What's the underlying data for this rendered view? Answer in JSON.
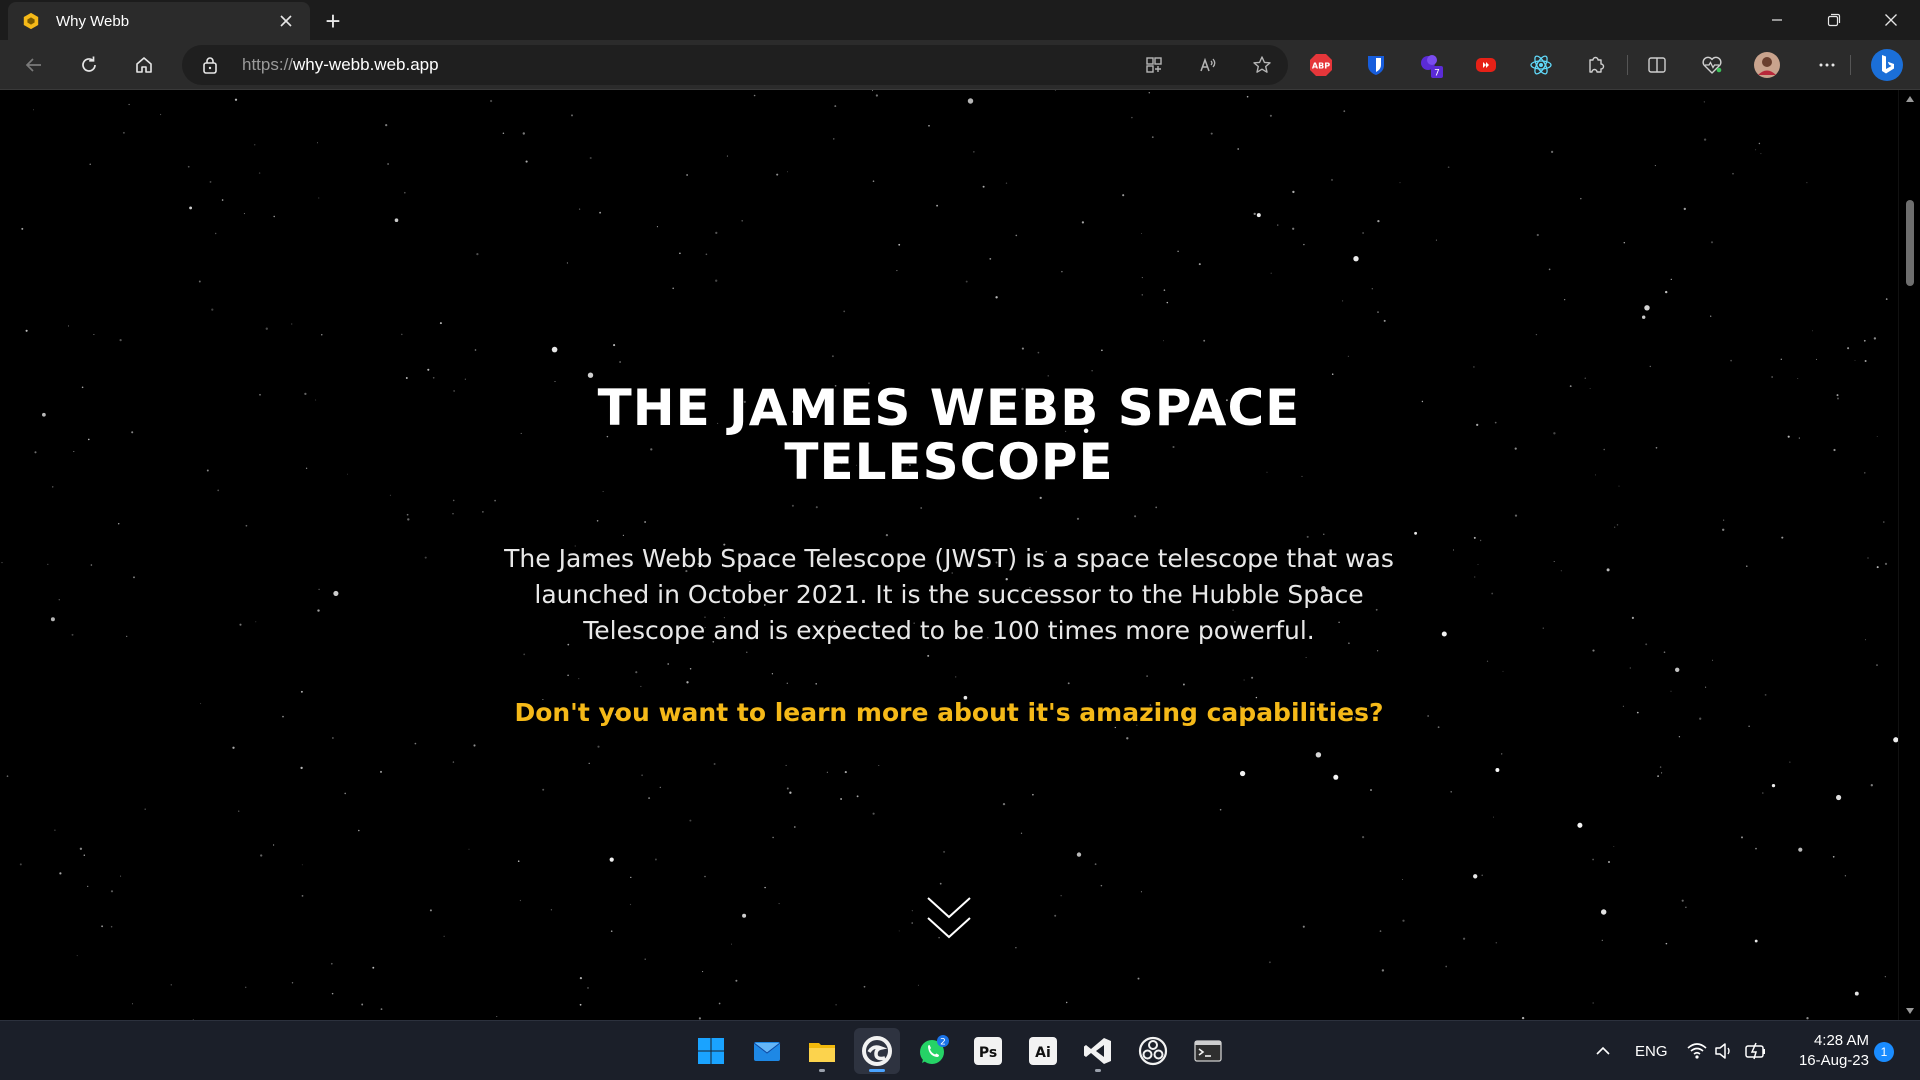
{
  "browser": {
    "tab": {
      "title": "Why Webb",
      "favicon": "hexagon-favicon-icon"
    },
    "new_tab_label": "+",
    "window_controls": [
      "minimize-icon",
      "restore-icon",
      "close-icon"
    ],
    "address": {
      "scheme": "https://",
      "host": "why-webb.web.app"
    },
    "extensions_badge": "7"
  },
  "page": {
    "title": "THE JAMES WEBB SPACE TELESCOPE",
    "description": "The James Webb Space Telescope (JWST) is a space telescope that was launched in October 2021. It is the successor to the Hubble Space Telescope and is expected to be 100 times more powerful.",
    "cta": "Don't you want to learn more about it's amazing capabilities?",
    "colors": {
      "background": "#000000",
      "accent": "#f5b918",
      "text": "#ffffff"
    }
  },
  "taskbar": {
    "whatsapp_badge": "2",
    "photoshop_label": "Ps",
    "illustrator_label": "Ai",
    "language": "ENG",
    "time": "4:28 AM",
    "date": "16-Aug-23",
    "notification_count": "1"
  }
}
